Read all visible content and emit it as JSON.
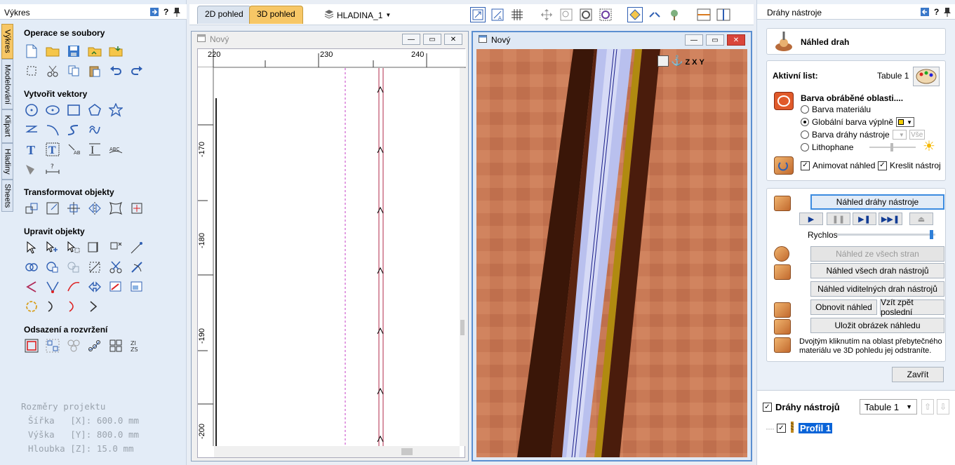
{
  "left_panel": {
    "title": "Výkres",
    "help_label": "?",
    "vertical_tabs": [
      "Výkres",
      "Modelování",
      "Klipart",
      "Hladiny",
      "Sheets"
    ],
    "sections": {
      "file_ops": "Operace se soubory",
      "create_vectors": "Vytvořit vektory",
      "transform": "Transformovat objekty",
      "edit": "Upravit objekty",
      "offset": "Odsazení a rozvržení"
    },
    "project": {
      "title": "Rozměry projektu",
      "width": "Šířka   [X]: 600.0 mm",
      "height": "Výška   [Y]: 800.0 mm",
      "depth": "Hloubka [Z]: 15.0 mm"
    }
  },
  "top_toolbar": {
    "tab_2d": "2D pohled",
    "tab_3d": "3D pohled",
    "layer": "HLADINA_1"
  },
  "view2d": {
    "title": "Nový",
    "ruler_top": [
      "220",
      "230",
      "240"
    ],
    "ruler_left": [
      "-170",
      "-180",
      "-190",
      "-200"
    ]
  },
  "view3d": {
    "title": "Nový",
    "axis_labels": [
      "Z",
      "X",
      "Y"
    ]
  },
  "right_panel": {
    "title": "Dráhy nástroje",
    "help_label": "?",
    "header_title": "Náhled drah",
    "active_sheet_label": "Aktivní list:",
    "active_sheet_value": "Tabule 1",
    "color_title": "Barva obráběné oblasti....",
    "opt_material": "Barva materiálu",
    "opt_global": "Globální barva výplně",
    "opt_toolpath": "Barva dráhy nástroje",
    "opt_all": "Vše",
    "opt_lithophane": "Lithophane",
    "animate": "Animovat náhled",
    "draw_tool": "Kreslit nástroj",
    "btn_preview_toolpath": "Náhled dráhy nástroje",
    "speed_label": "Rychlos",
    "speed_value": 0.98,
    "btn_all_sides": "Náhled ze všech stran",
    "btn_all_toolpaths": "Náhled všech drah nástrojů",
    "btn_visible_toolpaths": "Náhled viditelných drah nástrojů",
    "btn_refresh": "Obnovit náhled",
    "btn_undo_last": "Vzít zpět poslední",
    "btn_save_image": "Uložit obrázek náhledu",
    "hint": "Dvojtým kliknutím na oblast přebytečného materiálu ve 3D pohledu jej odstraníte.",
    "btn_close": "Zavřít",
    "toolpaths_label": "Dráhy nástrojů",
    "sheet_select": "Tabule 1",
    "tree_item": "Profil 1"
  },
  "colors": {
    "accent_tab": "#f7c766",
    "selection": "#0a64d8",
    "material": "#c97a56"
  }
}
